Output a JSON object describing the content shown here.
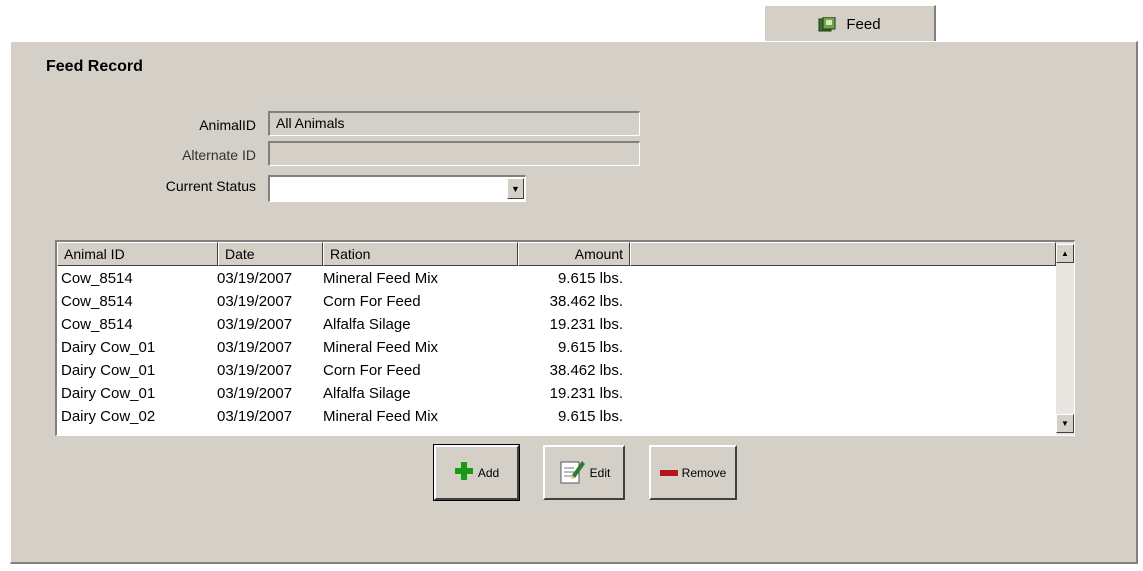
{
  "tab": {
    "label": "Feed",
    "icon": "feed-book-icon"
  },
  "panel": {
    "title": "Feed Record"
  },
  "form": {
    "animal_id_label": "AnimalID",
    "animal_id_value": "All Animals",
    "alternate_id_label": "Alternate ID",
    "alternate_id_value": "",
    "status_label": "Current Status",
    "status_value": ""
  },
  "grid": {
    "columns": [
      "Animal ID",
      "Date",
      "Ration",
      "Amount"
    ],
    "rows": [
      [
        "Cow_8514",
        "03/19/2007",
        "Mineral Feed Mix",
        "9.615 lbs."
      ],
      [
        "Cow_8514",
        "03/19/2007",
        "Corn For Feed",
        "38.462 lbs."
      ],
      [
        "Cow_8514",
        "03/19/2007",
        "Alfalfa Silage",
        "19.231 lbs."
      ],
      [
        "Dairy Cow_01",
        "03/19/2007",
        "Mineral Feed Mix",
        "9.615 lbs."
      ],
      [
        "Dairy Cow_01",
        "03/19/2007",
        "Corn For Feed",
        "38.462 lbs."
      ],
      [
        "Dairy Cow_01",
        "03/19/2007",
        "Alfalfa Silage",
        "19.231 lbs."
      ],
      [
        "Dairy Cow_02",
        "03/19/2007",
        "Mineral Feed Mix",
        "9.615 lbs."
      ]
    ]
  },
  "buttons": {
    "add": "Add",
    "edit": "Edit",
    "remove": "Remove"
  },
  "colors": {
    "face": "#d4d0c8",
    "add_icon": "#1a9a1a",
    "remove_icon": "#b01818"
  }
}
